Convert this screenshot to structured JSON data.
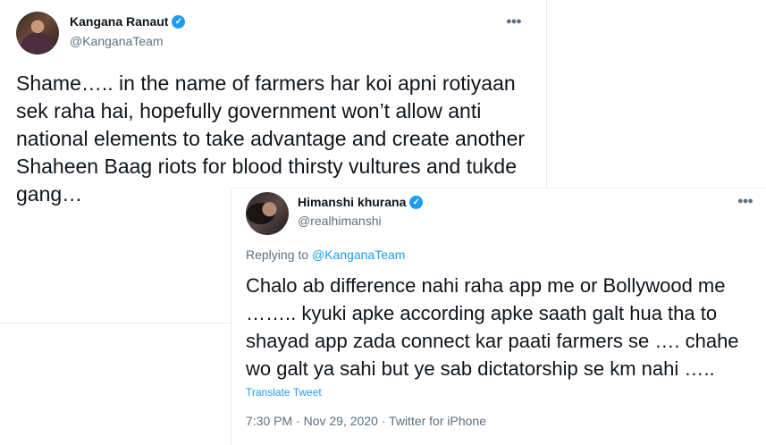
{
  "tweet1": {
    "name": "Kangana Ranaut",
    "handle": "@KanganaTeam",
    "text": "Shame….. in the name of farmers har koi apni rotiyaan sek raha hai, hopefully government won’t allow anti national elements to take advantage and create another Shaheen Baag riots for blood thirsty vultures and tukde gang…"
  },
  "tweet2": {
    "name": "Himanshi khurana",
    "handle": "@realhimanshi",
    "replying_to_prefix": "Replying to",
    "replying_to_mention": "@KanganaTeam",
    "text": "Chalo ab difference nahi raha app me or Bollywood me …….. kyuki apke according apke saath galt hua tha to shayad app zada connect kar paati farmers se …. chahe wo galt ya sahi but ye sab dictatorship se km nahi …..",
    "translate_label": "Translate Tweet",
    "meta": "7:30 PM · Nov 29, 2020 · Twitter for iPhone"
  },
  "icons": {
    "verified": "verified-badge-icon",
    "more": "more-options-icon"
  },
  "colors": {
    "accent": "#1d9bf0",
    "secondary_text": "#5b7083",
    "primary_text": "#0f1419"
  }
}
